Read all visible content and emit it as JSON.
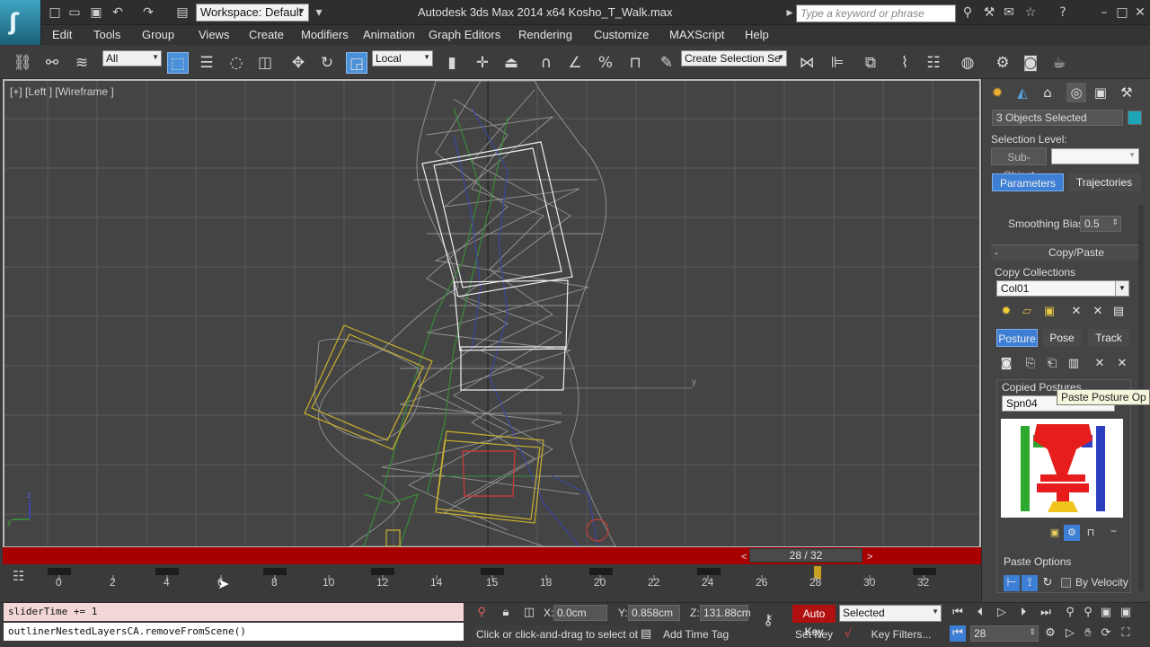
{
  "titlebar": {
    "workspace": "Workspace: Default",
    "title": "Autodesk 3ds Max  2014 x64      Kosho_T_Walk.max",
    "search_placeholder": "Type a keyword or phrase"
  },
  "menu": [
    "Edit",
    "Tools",
    "Group",
    "Views",
    "Create",
    "Modifiers",
    "Animation",
    "Graph Editors",
    "Rendering",
    "Customize",
    "MAXScript",
    "Help"
  ],
  "toolbar": {
    "filter": "All",
    "coord": "Local",
    "selection_set": "Create Selection Se"
  },
  "viewport": {
    "label": "[+] [Left ] [Wireframe ]",
    "axis_z": "z",
    "axis_y": "y"
  },
  "time_slider": {
    "frame_display": "28 / 32",
    "prev": "<",
    "next": ">"
  },
  "trackbar": {
    "ticks": [
      "0",
      "2",
      "4",
      "6",
      "8",
      "10",
      "12",
      "14",
      "15",
      "18",
      "20",
      "22",
      "24",
      "26",
      "28",
      "30",
      "32"
    ]
  },
  "command_panel": {
    "selection_name": "3 Objects Selected",
    "selection_level_label": "Selection Level:",
    "sub_object": "Sub-Object",
    "tab_parameters": "Parameters",
    "tab_trajectories": "Trajectories",
    "smoothing_bias_label": "Smoothing Bias:",
    "smoothing_bias_value": "0.5",
    "rollout_collapse": "-",
    "rollout_copy_paste": "Copy/Paste",
    "copy_collections_label": "Copy Collections",
    "collection_value": "Col01",
    "btn_posture": "Posture",
    "btn_pose": "Pose",
    "btn_track": "Track",
    "copied_postures_label": "Copied Postures",
    "posture_value": "Spn04",
    "tooltip": "Paste Posture Op",
    "paste_options_label": "Paste Options",
    "by_velocity": "By Velocity",
    "minus": "−"
  },
  "statusbar": {
    "mx_line1": "sliderTime += 1",
    "mx_line2": "outlinerNestedLayersCA.removeFromScene()",
    "x_label": "X:",
    "x_value": "0.0cm",
    "y_label": "Y:",
    "y_value": "0.858cm",
    "z_label": "Z:",
    "z_value": "131.88cm",
    "auto_key": "Auto Key",
    "key_mode": "Selected",
    "set_key": "Set Key",
    "key_filters": "Key Filters...",
    "prompt": "Click or click-and-drag to select object",
    "add_time_tag": "Add Time Tag",
    "current_frame": "28"
  }
}
